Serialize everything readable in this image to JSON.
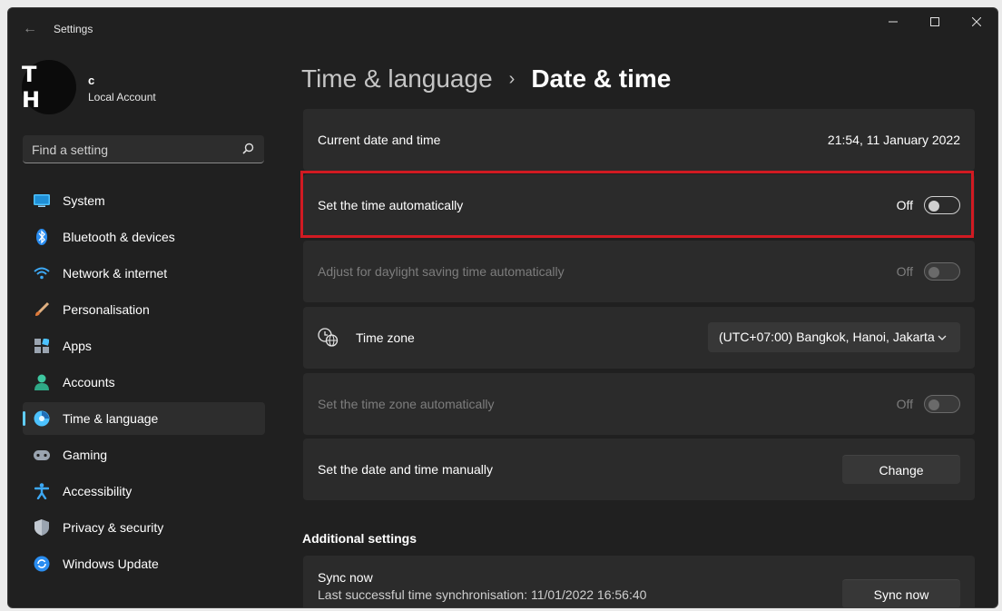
{
  "window": {
    "title": "Settings"
  },
  "profile": {
    "initials": "T H",
    "name": "c",
    "account_type": "Local Account"
  },
  "search": {
    "placeholder": "Find a setting"
  },
  "sidebar": {
    "items": [
      {
        "label": "System",
        "icon": "monitor-icon"
      },
      {
        "label": "Bluetooth & devices",
        "icon": "bluetooth-icon"
      },
      {
        "label": "Network & internet",
        "icon": "wifi-icon"
      },
      {
        "label": "Personalisation",
        "icon": "brush-icon"
      },
      {
        "label": "Apps",
        "icon": "apps-icon"
      },
      {
        "label": "Accounts",
        "icon": "person-icon"
      },
      {
        "label": "Time & language",
        "icon": "clock-globe-icon",
        "active": true
      },
      {
        "label": "Gaming",
        "icon": "gamepad-icon"
      },
      {
        "label": "Accessibility",
        "icon": "accessibility-icon"
      },
      {
        "label": "Privacy & security",
        "icon": "shield-icon"
      },
      {
        "label": "Windows Update",
        "icon": "update-icon"
      }
    ]
  },
  "breadcrumb": {
    "parent": "Time & language",
    "separator": "›",
    "current": "Date & time"
  },
  "settings": {
    "current_datetime": {
      "label": "Current date and time",
      "value": "21:54, 11 January 2022"
    },
    "auto_time": {
      "label": "Set the time automatically",
      "state": "Off",
      "enabled": true
    },
    "daylight_saving": {
      "label": "Adjust for daylight saving time automatically",
      "state": "Off",
      "enabled": false
    },
    "time_zone": {
      "label": "Time zone",
      "value": "(UTC+07:00) Bangkok, Hanoi, Jakarta"
    },
    "auto_timezone": {
      "label": "Set the time zone automatically",
      "state": "Off",
      "enabled": false
    },
    "manual": {
      "label": "Set the date and time manually",
      "button": "Change"
    }
  },
  "additional": {
    "title": "Additional settings",
    "sync": {
      "label": "Sync now",
      "detail": "Last successful time synchronisation: 11/01/2022 16:56:40",
      "button": "Sync now"
    }
  },
  "colors": {
    "accent": "#60cdff",
    "highlight": "#d11a22",
    "background": "#202020",
    "card": "#2b2b2b"
  }
}
